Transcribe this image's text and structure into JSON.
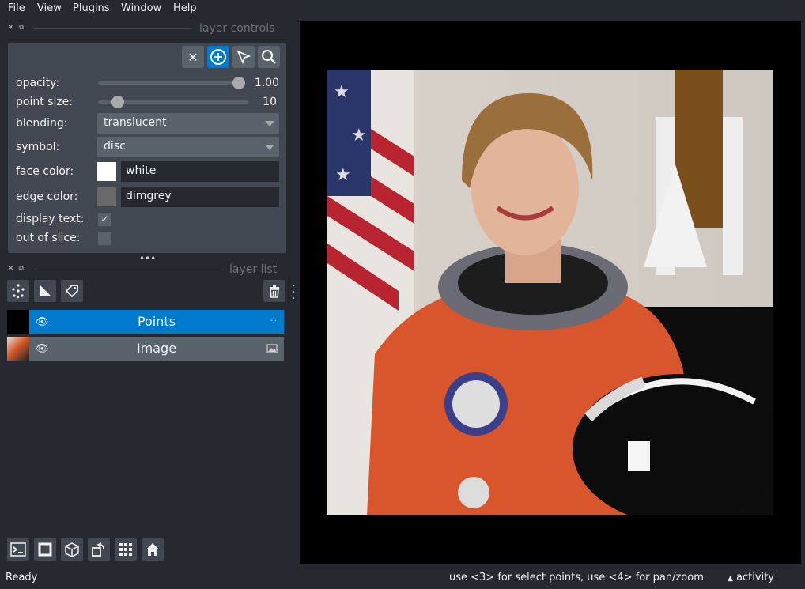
{
  "menubar": {
    "items": [
      {
        "label": "File"
      },
      {
        "label": "View"
      },
      {
        "label": "Plugins"
      },
      {
        "label": "Window"
      },
      {
        "label": "Help"
      }
    ]
  },
  "layer_controls": {
    "title": "layer controls",
    "tools": [
      "close-icon",
      "add-point-icon",
      "select-arrow-icon",
      "zoom-icon"
    ],
    "opacity": {
      "label": "opacity:",
      "value": "1.00",
      "fraction": 1.0
    },
    "point_size": {
      "label": "point size:",
      "value": "10",
      "fraction": 0.13
    },
    "blending": {
      "label": "blending:",
      "value": "translucent"
    },
    "symbol": {
      "label": "symbol:",
      "value": "disc"
    },
    "face_color": {
      "label": "face color:",
      "value": "white",
      "swatch": "#ffffff"
    },
    "edge_color": {
      "label": "edge color:",
      "value": "dimgrey",
      "swatch": "#696969"
    },
    "display_text": {
      "label": "display text:",
      "checked": true,
      "check_glyph": "✓"
    },
    "out_of_slice": {
      "label": "out of slice:",
      "checked": false
    }
  },
  "layer_list": {
    "title": "layer list",
    "layers": [
      {
        "name": "Points",
        "selected": true,
        "visible": true,
        "type_icon": "points-icon"
      },
      {
        "name": "Image",
        "selected": false,
        "visible": true,
        "type_icon": "image-icon"
      }
    ]
  },
  "status": {
    "left": "Ready",
    "hint": "use <3> for select points, use <4> for pan/zoom",
    "activity": "activity"
  },
  "colors": {
    "background": "#262930",
    "panel": "#414851",
    "accent": "#007acc",
    "canvas": "#000000"
  }
}
